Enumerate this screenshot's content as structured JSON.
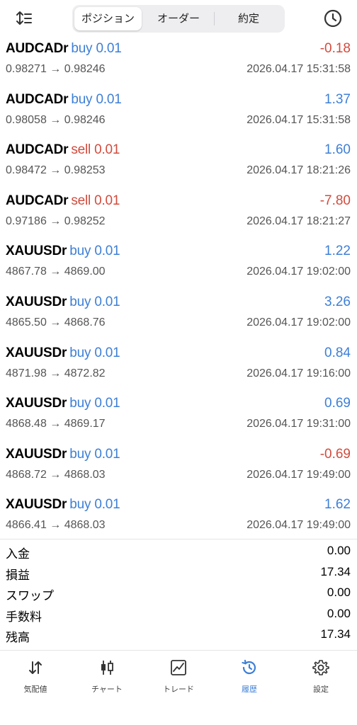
{
  "header": {
    "tabs": [
      {
        "label": "ポジション",
        "active": true
      },
      {
        "label": "オーダー",
        "active": false
      },
      {
        "label": "約定",
        "active": false
      }
    ]
  },
  "trades": [
    {
      "symbol": "AUDCADr",
      "side": "buy 0.01",
      "type": "buy",
      "profit": "-0.18",
      "sign": "neg",
      "prices": "0.98271 → 0.98246",
      "time": "2026.04.17 15:31:58"
    },
    {
      "symbol": "AUDCADr",
      "side": "buy 0.01",
      "type": "buy",
      "profit": "1.37",
      "sign": "pos",
      "prices": "0.98058 → 0.98246",
      "time": "2026.04.17 15:31:58"
    },
    {
      "symbol": "AUDCADr",
      "side": "sell 0.01",
      "type": "sell",
      "profit": "1.60",
      "sign": "pos",
      "prices": "0.98472 → 0.98253",
      "time": "2026.04.17 18:21:26"
    },
    {
      "symbol": "AUDCADr",
      "side": "sell 0.01",
      "type": "sell",
      "profit": "-7.80",
      "sign": "neg",
      "prices": "0.97186 → 0.98252",
      "time": "2026.04.17 18:21:27"
    },
    {
      "symbol": "XAUUSDr",
      "side": "buy 0.01",
      "type": "buy",
      "profit": "1.22",
      "sign": "pos",
      "prices": "4867.78 → 4869.00",
      "time": "2026.04.17 19:02:00"
    },
    {
      "symbol": "XAUUSDr",
      "side": "buy 0.01",
      "type": "buy",
      "profit": "3.26",
      "sign": "pos",
      "prices": "4865.50 → 4868.76",
      "time": "2026.04.17 19:02:00"
    },
    {
      "symbol": "XAUUSDr",
      "side": "buy 0.01",
      "type": "buy",
      "profit": "0.84",
      "sign": "pos",
      "prices": "4871.98 → 4872.82",
      "time": "2026.04.17 19:16:00"
    },
    {
      "symbol": "XAUUSDr",
      "side": "buy 0.01",
      "type": "buy",
      "profit": "0.69",
      "sign": "pos",
      "prices": "4868.48 → 4869.17",
      "time": "2026.04.17 19:31:00"
    },
    {
      "symbol": "XAUUSDr",
      "side": "buy 0.01",
      "type": "buy",
      "profit": "-0.69",
      "sign": "neg",
      "prices": "4868.72 → 4868.03",
      "time": "2026.04.17 19:49:00"
    },
    {
      "symbol": "XAUUSDr",
      "side": "buy 0.01",
      "type": "buy",
      "profit": "1.62",
      "sign": "pos",
      "prices": "4866.41 → 4868.03",
      "time": "2026.04.17 19:49:00"
    }
  ],
  "summary": [
    {
      "label": "入金",
      "value": "0.00"
    },
    {
      "label": "損益",
      "value": "17.34"
    },
    {
      "label": "スワップ",
      "value": "0.00"
    },
    {
      "label": "手数料",
      "value": "0.00"
    },
    {
      "label": "残高",
      "value": "17.34"
    }
  ],
  "tabbar": [
    {
      "label": "気配値",
      "icon": "quotes-arrows-icon",
      "active": false
    },
    {
      "label": "チャート",
      "icon": "candlestick-icon",
      "active": false
    },
    {
      "label": "トレード",
      "icon": "trade-chart-icon",
      "active": false
    },
    {
      "label": "履歴",
      "icon": "history-clock-icon",
      "active": true
    },
    {
      "label": "設定",
      "icon": "gear-icon",
      "active": false
    }
  ],
  "colors": {
    "accent": "#3d7fd6",
    "loss": "#d24b3d",
    "text_secondary": "#555555"
  }
}
